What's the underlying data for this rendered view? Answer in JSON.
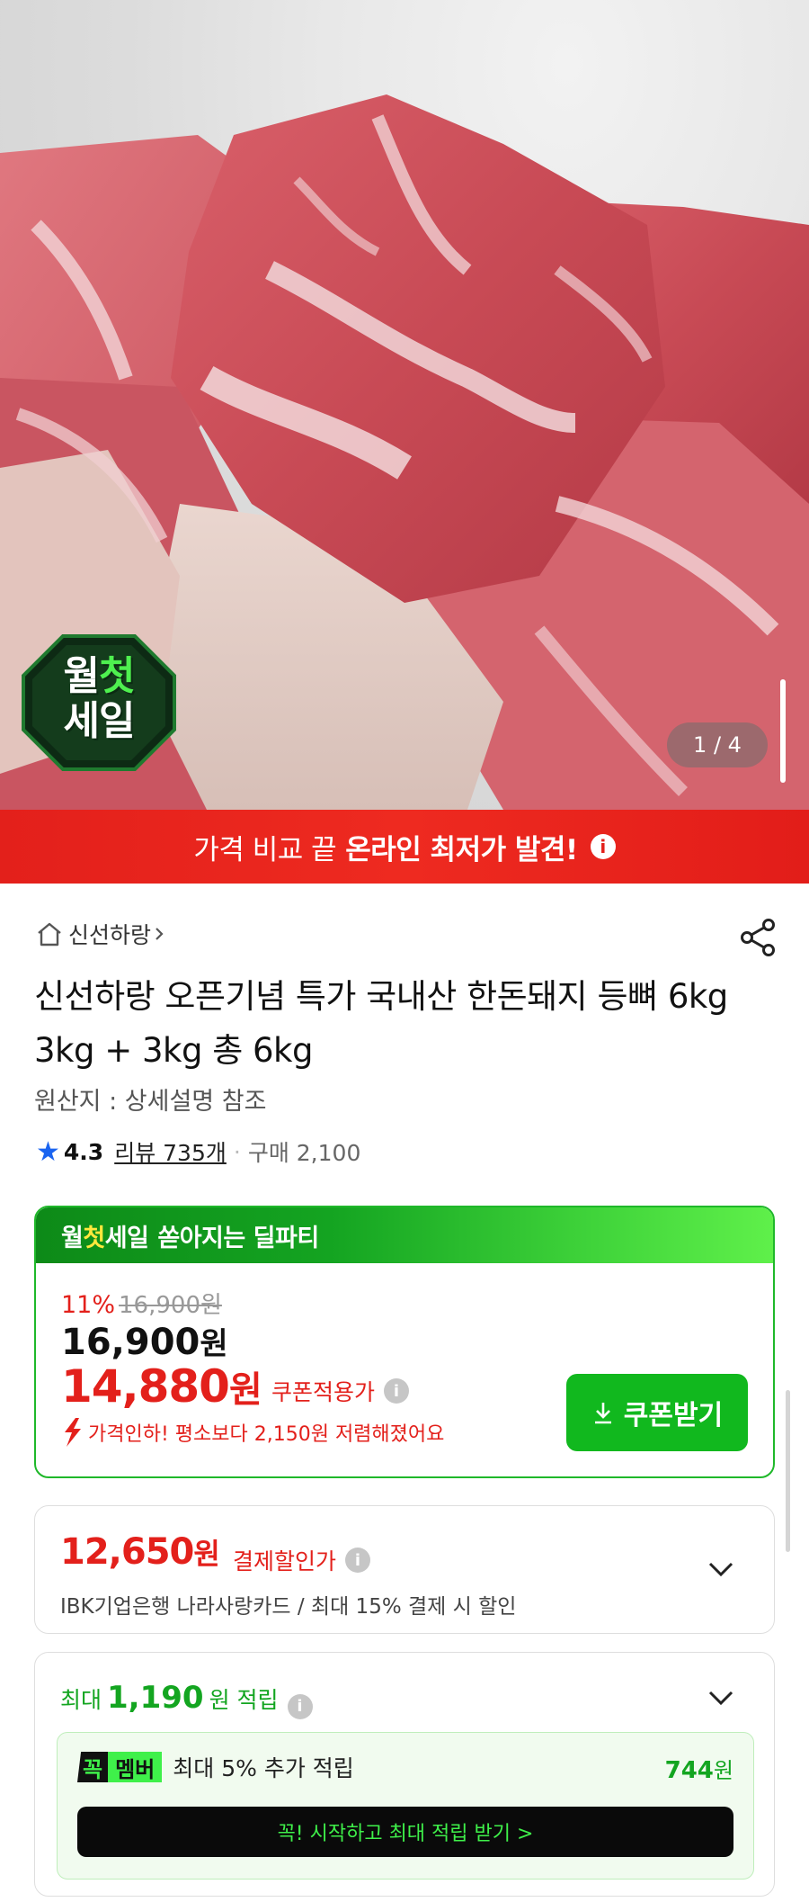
{
  "hero": {
    "counter": "1 / 4",
    "badge": {
      "line1_a": "월",
      "line1_b": "첫",
      "line2": "세일"
    }
  },
  "banner": {
    "text_light": "가격 비교 끝",
    "text_bold": "온라인 최저가 발견!",
    "info": "i"
  },
  "product": {
    "store": "신선하랑",
    "title": "신선하랑 오픈기념 특가 국내산 한돈돼지 등뼈 6kg 3kg + 3kg 총 6kg",
    "origin": "원산지 : 상세설명 참조",
    "rating": "4.3",
    "reviews": "리뷰 735개",
    "purchases": "구매 2,100"
  },
  "deal": {
    "head_a": "월",
    "head_b": "첫",
    "head_c": "세일",
    "head_sub": "쏟아지는 딜파티",
    "discount_rate": "11%",
    "original_price": "16,900",
    "original_unit": "원",
    "price": "16,900",
    "price_unit": "원",
    "coupon_price": "14,880",
    "coupon_unit": "원",
    "coupon_label": "쿠폰적용가",
    "drop_note": "가격인하! 평소보다 2,150원 저렴해졌어요",
    "coupon_button": "쿠폰받기"
  },
  "payment": {
    "amount": "12,650",
    "unit": "원",
    "label": "결제할인가",
    "card": "IBK기업은행 나라사랑카드 / 최대 15% 결제 시 할인"
  },
  "points": {
    "max_prefix": "최대",
    "max_amount": "1,190",
    "max_suffix": "원 적립",
    "badge_a": "꼭",
    "badge_b": "멤버",
    "extra": "최대 5% 추가 적립",
    "extra_points": "744",
    "extra_unit": "원",
    "cta": "꼭! 시작하고 최대 적립 받기 >"
  }
}
